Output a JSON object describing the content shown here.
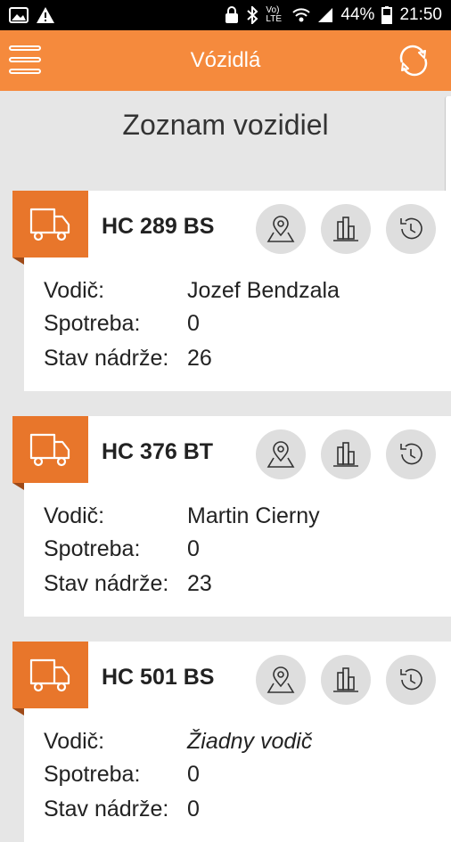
{
  "status_bar": {
    "battery_percent": "44%",
    "time": "21:50",
    "network_label": "Vo) LTE"
  },
  "app_bar": {
    "title": "Vózidlá",
    "background_color": "#f58a3d",
    "menu_icon": "hamburger-icon",
    "refresh_icon": "refresh-icon"
  },
  "page": {
    "heading": "Zoznam vozidiel"
  },
  "labels": {
    "driver": "Vodič:",
    "consumption": "Spotreba:",
    "tank": "Stav nádrže:"
  },
  "vehicles": [
    {
      "plate": "HC 289 BS",
      "driver": "Jozef Bendzala",
      "consumption": "0",
      "tank": "26"
    },
    {
      "plate": "HC 376 BT",
      "driver": "Martin Cierny",
      "consumption": "0",
      "tank": "23"
    },
    {
      "plate": "HC 501 BS",
      "driver": "Žiadny vodič",
      "consumption": "0",
      "tank": "0"
    }
  ],
  "accent_color": "#e8762b"
}
